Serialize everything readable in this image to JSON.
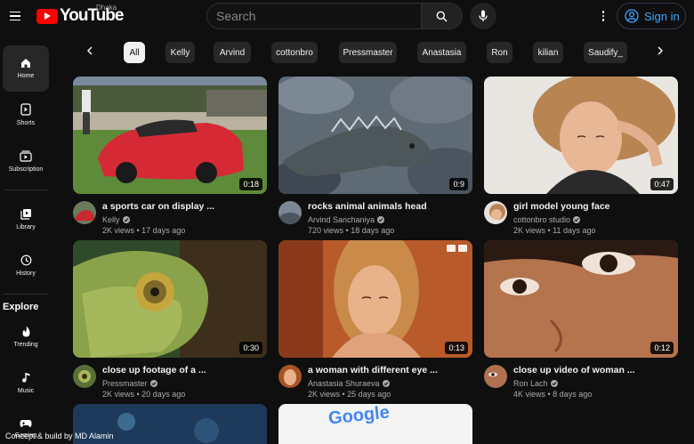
{
  "header": {
    "logo_text": "YouTube",
    "region": "Dhaka",
    "search_placeholder": "Search",
    "signin_label": "Sign in"
  },
  "sidebar": {
    "items": [
      {
        "label": "Home",
        "icon": "home-icon"
      },
      {
        "label": "Shorts",
        "icon": "shorts-icon"
      },
      {
        "label": "Subscription",
        "icon": "subscriptions-icon"
      },
      {
        "label": "Library",
        "icon": "library-icon"
      },
      {
        "label": "History",
        "icon": "history-icon"
      }
    ],
    "explore_title": "Explore",
    "explore_items": [
      {
        "label": "Trending",
        "icon": "fire-icon"
      },
      {
        "label": "Music",
        "icon": "music-icon"
      },
      {
        "label": "Gaming",
        "icon": "gaming-icon"
      }
    ]
  },
  "chips": [
    "All",
    "Kelly",
    "Arvind",
    "cottonbro",
    "Pressmaster",
    "Anastasia",
    "Ron",
    "kilian",
    "Saudify_"
  ],
  "videos": [
    {
      "title": "a sports car on display ...",
      "channel": "Kelly",
      "views": "2K views",
      "age": "17 days ago",
      "duration": "0:18"
    },
    {
      "title": "rocks animal animals head",
      "channel": "Arvind Sanchaniya",
      "views": "720 views",
      "age": "18 days ago",
      "duration": "0:9"
    },
    {
      "title": "girl model young face",
      "channel": "cottonbro studio",
      "views": "2K views",
      "age": "11 days ago",
      "duration": "0:47"
    },
    {
      "title": "close up footage of a ...",
      "channel": "Pressmaster",
      "views": "2K views",
      "age": "20 days ago",
      "duration": "0:30"
    },
    {
      "title": "a woman with different eye ...",
      "channel": "Anastasia Shuraeva",
      "views": "2K views",
      "age": "25 days ago",
      "duration": "0:13"
    },
    {
      "title": "close up video of woman ...",
      "channel": "Ron Lach",
      "views": "4K views",
      "age": "8 days ago",
      "duration": "0:12"
    }
  ],
  "partial_thumbnails": [
    {
      "logo_text": "Google"
    }
  ],
  "footer": {
    "credit": "Concept & build by MD Alamin"
  },
  "colors": {
    "background": "#0f0f0f",
    "brand_red": "#ff0000",
    "link_blue": "#3ea6ff",
    "chip_bg": "#272727"
  }
}
